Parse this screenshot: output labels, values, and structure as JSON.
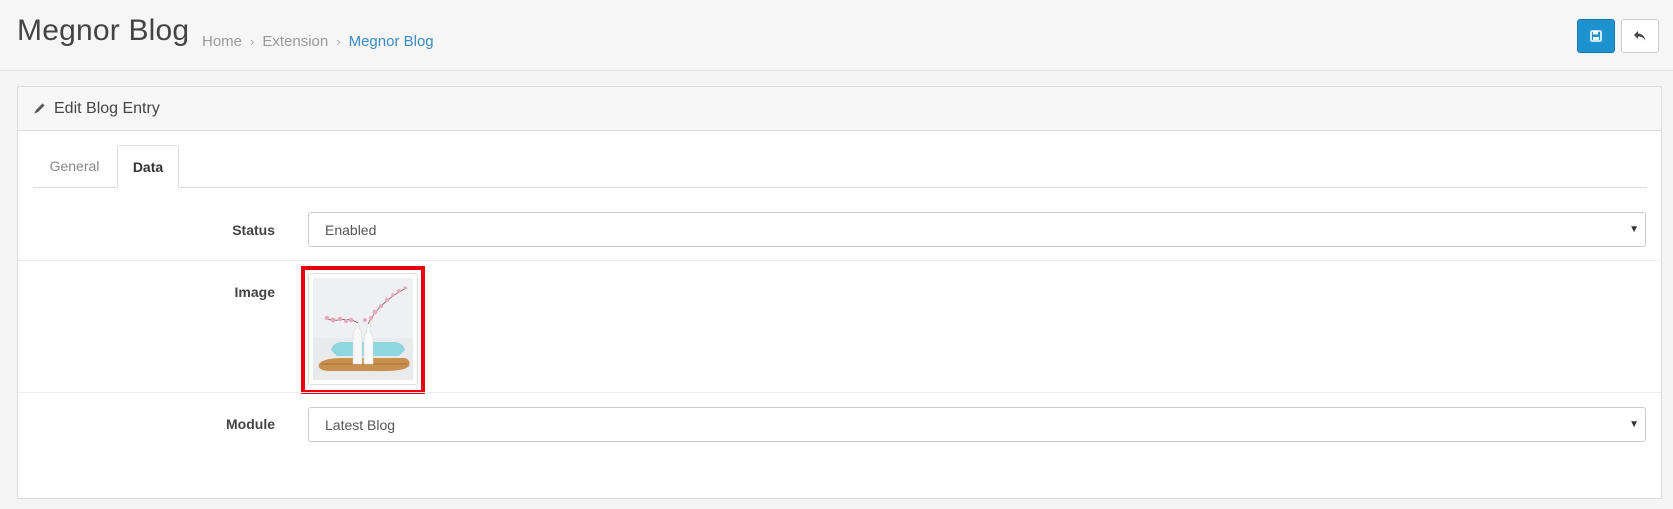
{
  "header": {
    "title": "Megnor Blog",
    "breadcrumb": [
      "Home",
      "Extension",
      "Megnor Blog"
    ],
    "buttons": {
      "save_icon": "save-icon",
      "back_icon": "reply-icon"
    },
    "colors": {
      "primary": "#1e91cf",
      "link": "#3b8cc6"
    }
  },
  "panel": {
    "heading": "Edit Blog Entry",
    "tabs": [
      "General",
      "Data"
    ],
    "active_tab": "Data"
  },
  "form": {
    "status": {
      "label": "Status",
      "value": "Enabled"
    },
    "image": {
      "label": "Image",
      "highlight_color": "#e8000f"
    },
    "module": {
      "label": "Module",
      "value": "Latest Blog"
    }
  }
}
